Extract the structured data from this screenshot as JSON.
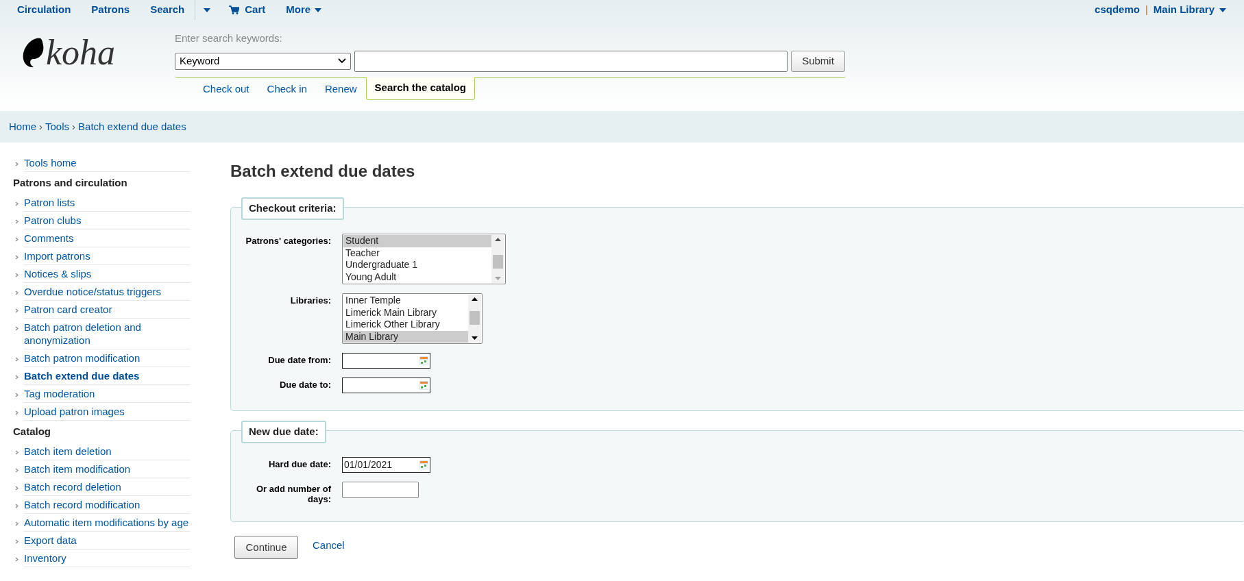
{
  "nav": {
    "items": [
      {
        "kind": "link",
        "label": "Circulation"
      },
      {
        "kind": "link",
        "label": "Patrons"
      },
      {
        "kind": "link",
        "label": "Search"
      },
      {
        "kind": "caret"
      },
      {
        "kind": "cart",
        "label": "Cart"
      },
      {
        "kind": "menu",
        "label": "More"
      }
    ],
    "user": "csqdemo",
    "divider": "|",
    "library": "Main Library"
  },
  "logo": {
    "text": "koha"
  },
  "search": {
    "prompt": "Enter search keywords:",
    "index": "Keyword",
    "button": "Submit"
  },
  "tabs": [
    {
      "label": "Check out",
      "selected": false
    },
    {
      "label": "Check in",
      "selected": false
    },
    {
      "label": "Renew",
      "selected": false
    },
    {
      "label": "Search the catalog",
      "selected": true
    }
  ],
  "breadcrumb": [
    {
      "label": "Home",
      "separator": "›"
    },
    {
      "label": "Tools",
      "separator": "›"
    },
    {
      "label": "Batch extend due dates"
    }
  ],
  "sidebar": [
    {
      "items": [
        {
          "label": "Tools home",
          "selected": false
        }
      ]
    },
    {
      "heading": "Patrons and circulation",
      "items": [
        {
          "label": "Patron lists",
          "selected": false
        },
        {
          "label": "Patron clubs",
          "selected": false
        },
        {
          "label": "Comments",
          "selected": false
        },
        {
          "label": "Import patrons",
          "selected": false
        },
        {
          "label": "Notices & slips",
          "selected": false
        },
        {
          "label": "Overdue notice/status triggers",
          "selected": false
        },
        {
          "label": "Patron card creator",
          "selected": false
        },
        {
          "label": "Batch patron deletion and anonymization",
          "selected": false
        },
        {
          "label": "Batch patron modification",
          "selected": false
        },
        {
          "label": "Batch extend due dates",
          "selected": true
        },
        {
          "label": "Tag moderation",
          "selected": false
        },
        {
          "label": "Upload patron images",
          "selected": false
        }
      ]
    },
    {
      "heading": "Catalog",
      "items": [
        {
          "label": "Batch item deletion",
          "selected": false
        },
        {
          "label": "Batch item modification",
          "selected": false
        },
        {
          "label": "Batch record deletion",
          "selected": false
        },
        {
          "label": "Batch record modification",
          "selected": false
        },
        {
          "label": "Automatic item modifications by age",
          "selected": false
        },
        {
          "label": "Export data",
          "selected": false
        },
        {
          "label": "Inventory",
          "selected": false
        }
      ]
    }
  ],
  "form": {
    "title": "Batch extend due dates",
    "fieldsets": [
      {
        "legend": "Checkout criteria:",
        "fields": [
          {
            "kind": "listbox",
            "label": "Patrons' categories:",
            "options": [
              {
                "label": "Student",
                "selected": true
              },
              {
                "label": "Teacher",
                "selected": false
              },
              {
                "label": "Undergraduate 1",
                "selected": false
              },
              {
                "label": "Young Adult",
                "selected": false
              }
            ]
          },
          {
            "kind": "listbox",
            "label": "Libraries:",
            "options": [
              {
                "label": "Inner Temple",
                "selected": false
              },
              {
                "label": "Limerick Main Library",
                "selected": false
              },
              {
                "label": "Limerick Other Library",
                "selected": false
              },
              {
                "label": "Main Library",
                "selected": true
              }
            ]
          },
          {
            "kind": "date",
            "label": "Due date from:"
          },
          {
            "kind": "date",
            "label": "Due date to:"
          }
        ]
      },
      {
        "legend": "New due date:",
        "fields": [
          {
            "kind": "date",
            "label": "Hard due date:",
            "value": "01/01/2021"
          },
          {
            "kind": "text",
            "label": "Or add number of days:"
          }
        ]
      }
    ],
    "submit": "Continue",
    "cancel": "Cancel"
  }
}
